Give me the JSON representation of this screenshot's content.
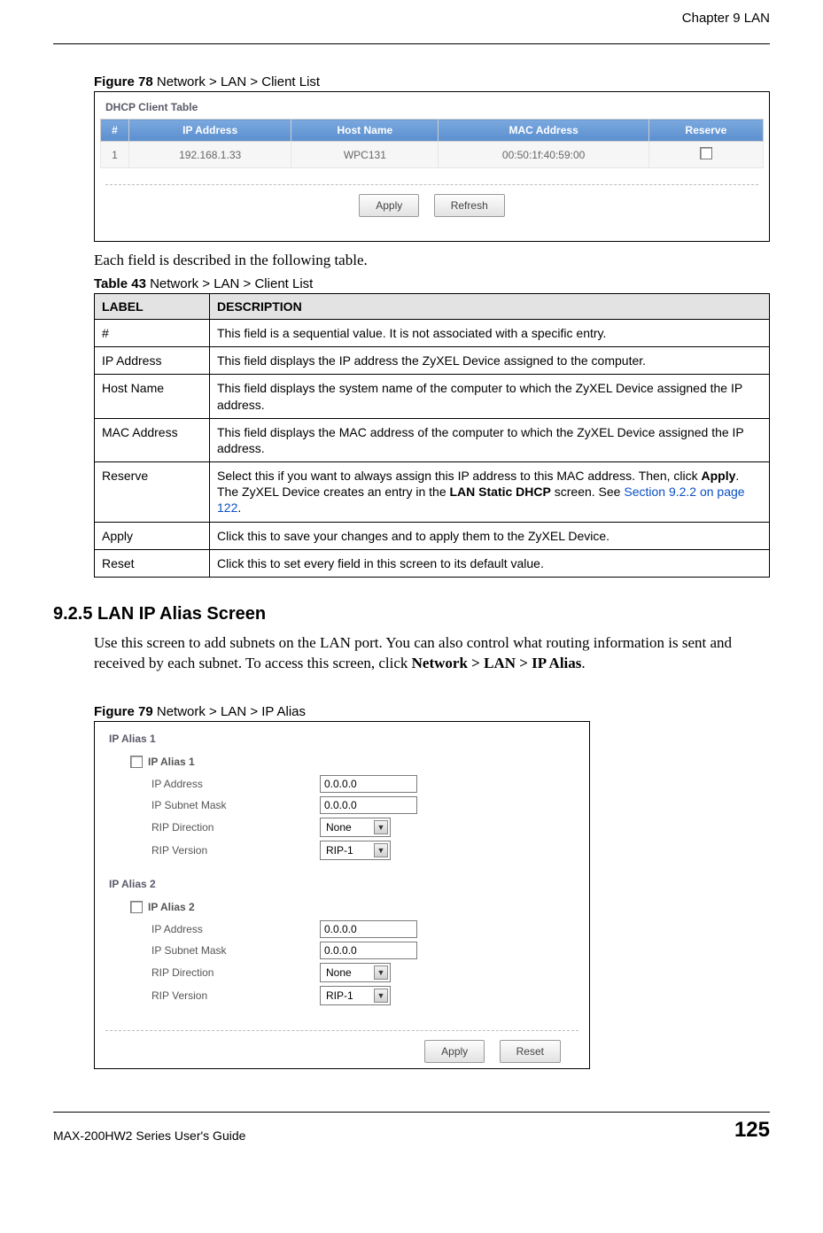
{
  "chapter_head": "Chapter 9 LAN",
  "figure78": {
    "caption_label": "Figure 78   ",
    "caption_text": "Network > LAN > Client List",
    "panel_title": "DHCP Client Table",
    "headers": {
      "num": "#",
      "ip": "IP Address",
      "host": "Host Name",
      "mac": "MAC Address",
      "reserve": "Reserve"
    },
    "row": {
      "num": "1",
      "ip": "192.168.1.33",
      "host": "WPC131",
      "mac": "00:50:1f:40:59:00"
    },
    "apply_btn": "Apply",
    "refresh_btn": "Refresh"
  },
  "intro_line": "Each field is described in the following table.",
  "table43": {
    "caption_label": "Table 43   ",
    "caption_text": "Network > LAN > Client List",
    "header_label": "LABEL",
    "header_desc": "DESCRIPTION",
    "rows": {
      "r0": {
        "label": "#",
        "desc": "This field is a sequential value. It is not associated with a specific entry."
      },
      "r1": {
        "label": "IP Address",
        "desc": "This field displays the IP address the ZyXEL Device assigned to the computer."
      },
      "r2": {
        "label": "Host Name",
        "desc": "This field displays the system name of the computer to which the ZyXEL Device assigned the IP address."
      },
      "r3": {
        "label": "MAC Address",
        "desc": "This field displays the MAC address of the computer to which the ZyXEL Device assigned the IP address."
      },
      "r4": {
        "label": "Reserve",
        "desc_pre": "Select this if you want to always assign this IP address to this MAC address. Then, click ",
        "desc_bold1": "Apply",
        "desc_mid": ". The ZyXEL Device creates an entry in the ",
        "desc_bold2": "LAN Static DHCP",
        "desc_post": " screen. See ",
        "link": "Section 9.2.2 on page 122",
        "desc_end": "."
      },
      "r5": {
        "label": "Apply",
        "desc": "Click this to save your changes and to apply them to the ZyXEL Device."
      },
      "r6": {
        "label": "Reset",
        "desc": "Click this to set every field in this screen to its default value."
      }
    }
  },
  "section_head": "9.2.5  LAN IP Alias Screen",
  "section_body_pre": "Use this screen to add subnets on the LAN port. You can also control what routing information is sent and received by each subnet. To access this screen, click ",
  "section_body_bold": "Network > LAN > IP Alias",
  "section_body_post": ".",
  "figure79": {
    "caption_label": "Figure 79   ",
    "caption_text": "Network > LAN > IP Alias",
    "alias1_title": "IP Alias 1",
    "alias2_title": "IP Alias 2",
    "chk1_label": "IP Alias 1",
    "chk2_label": "IP Alias 2",
    "lbl_ip": "IP Address",
    "lbl_mask": "IP Subnet Mask",
    "lbl_ripdir": "RIP Direction",
    "lbl_ripver": "RIP Version",
    "val_ip": "0.0.0.0",
    "val_mask": "0.0.0.0",
    "val_ripdir": "None",
    "val_ripver": "RIP-1",
    "apply_btn": "Apply",
    "reset_btn": "Reset"
  },
  "footer": {
    "left": "MAX-200HW2 Series User's Guide",
    "right": "125"
  }
}
